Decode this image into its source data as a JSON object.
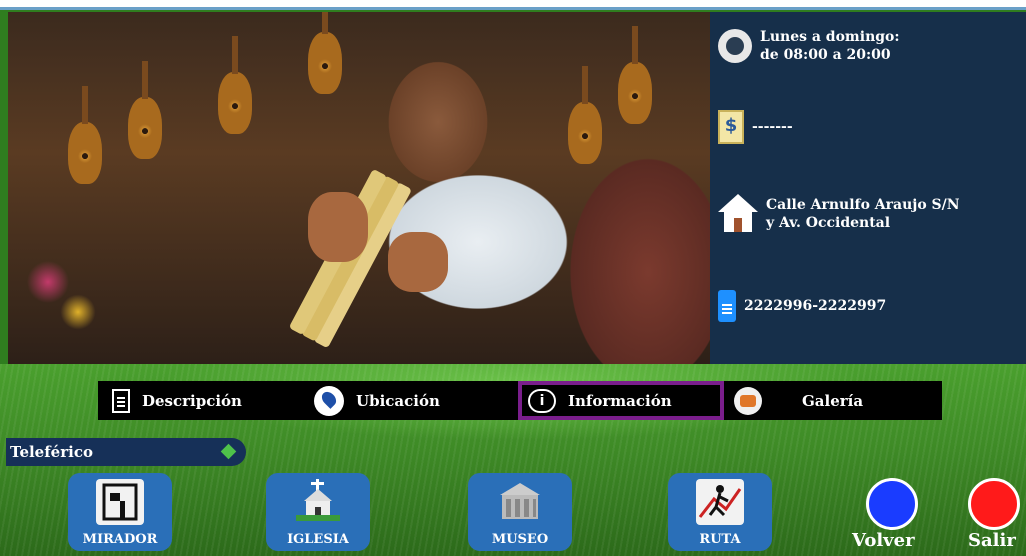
{
  "info": {
    "hours": "Lunes a domingo:\nde 08:00 a 20:00",
    "price": "-------",
    "address": "Calle Arnulfo Araujo S/N\ny Av. Occidental",
    "phone": "2222996-2222997"
  },
  "tabs": [
    {
      "label": "Descripción",
      "icon": "document-icon"
    },
    {
      "label": "Ubicación",
      "icon": "location-pin-icon"
    },
    {
      "label": "Información",
      "icon": "info-icon",
      "active": true
    },
    {
      "label": "Galería",
      "icon": "camera-icon"
    }
  ],
  "location": {
    "label": "Teleférico"
  },
  "nav": [
    {
      "label": "MIRADOR",
      "icon": "mirador-icon"
    },
    {
      "label": "IGLESIA",
      "icon": "church-icon"
    },
    {
      "label": "MUSEO",
      "icon": "museum-icon"
    },
    {
      "label": "RUTA",
      "icon": "route-map-icon"
    }
  ],
  "actions": {
    "back": "Volver",
    "exit": "Salir"
  },
  "colors": {
    "info_panel": "#162f4a",
    "tab_active_border": "#7a1e8c",
    "nav_button": "#2a6fb8",
    "back_button": "#1a3cff",
    "exit_button": "#ff1a1a"
  }
}
